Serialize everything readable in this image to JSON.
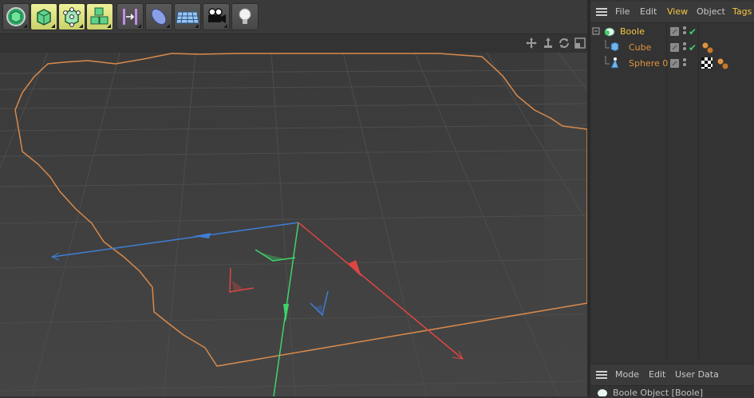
{
  "object_manager": {
    "menu": [
      "File",
      "Edit",
      "View",
      "Object",
      "Tags"
    ],
    "objects": [
      {
        "name": "Boole",
        "color": "#f5c842"
      },
      {
        "name": "Cube",
        "color": "#e0933e"
      },
      {
        "name": "Sphere 0",
        "color": "#e0933e"
      }
    ]
  },
  "attribute_manager": {
    "menu": [
      "Mode",
      "Edit",
      "User Data"
    ],
    "title": "Boole Object [Boole]"
  },
  "colors": {
    "selection_outline": "#d98a4b",
    "axis_x": "#e04545",
    "axis_y": "#3fd36a",
    "axis_z": "#3d7fd8",
    "active_tool": "#d9e07a"
  },
  "icons": {
    "toolbar": [
      "undo-view-icon",
      "cube-icon",
      "points-icon",
      "model-icon",
      "array-icon",
      "deformer-icon",
      "floor-icon",
      "camera-icon",
      "light-icon"
    ],
    "viewport_nav": [
      "move-view-icon",
      "zoom-view-icon",
      "rotate-view-icon",
      "maximize-view-icon"
    ]
  }
}
